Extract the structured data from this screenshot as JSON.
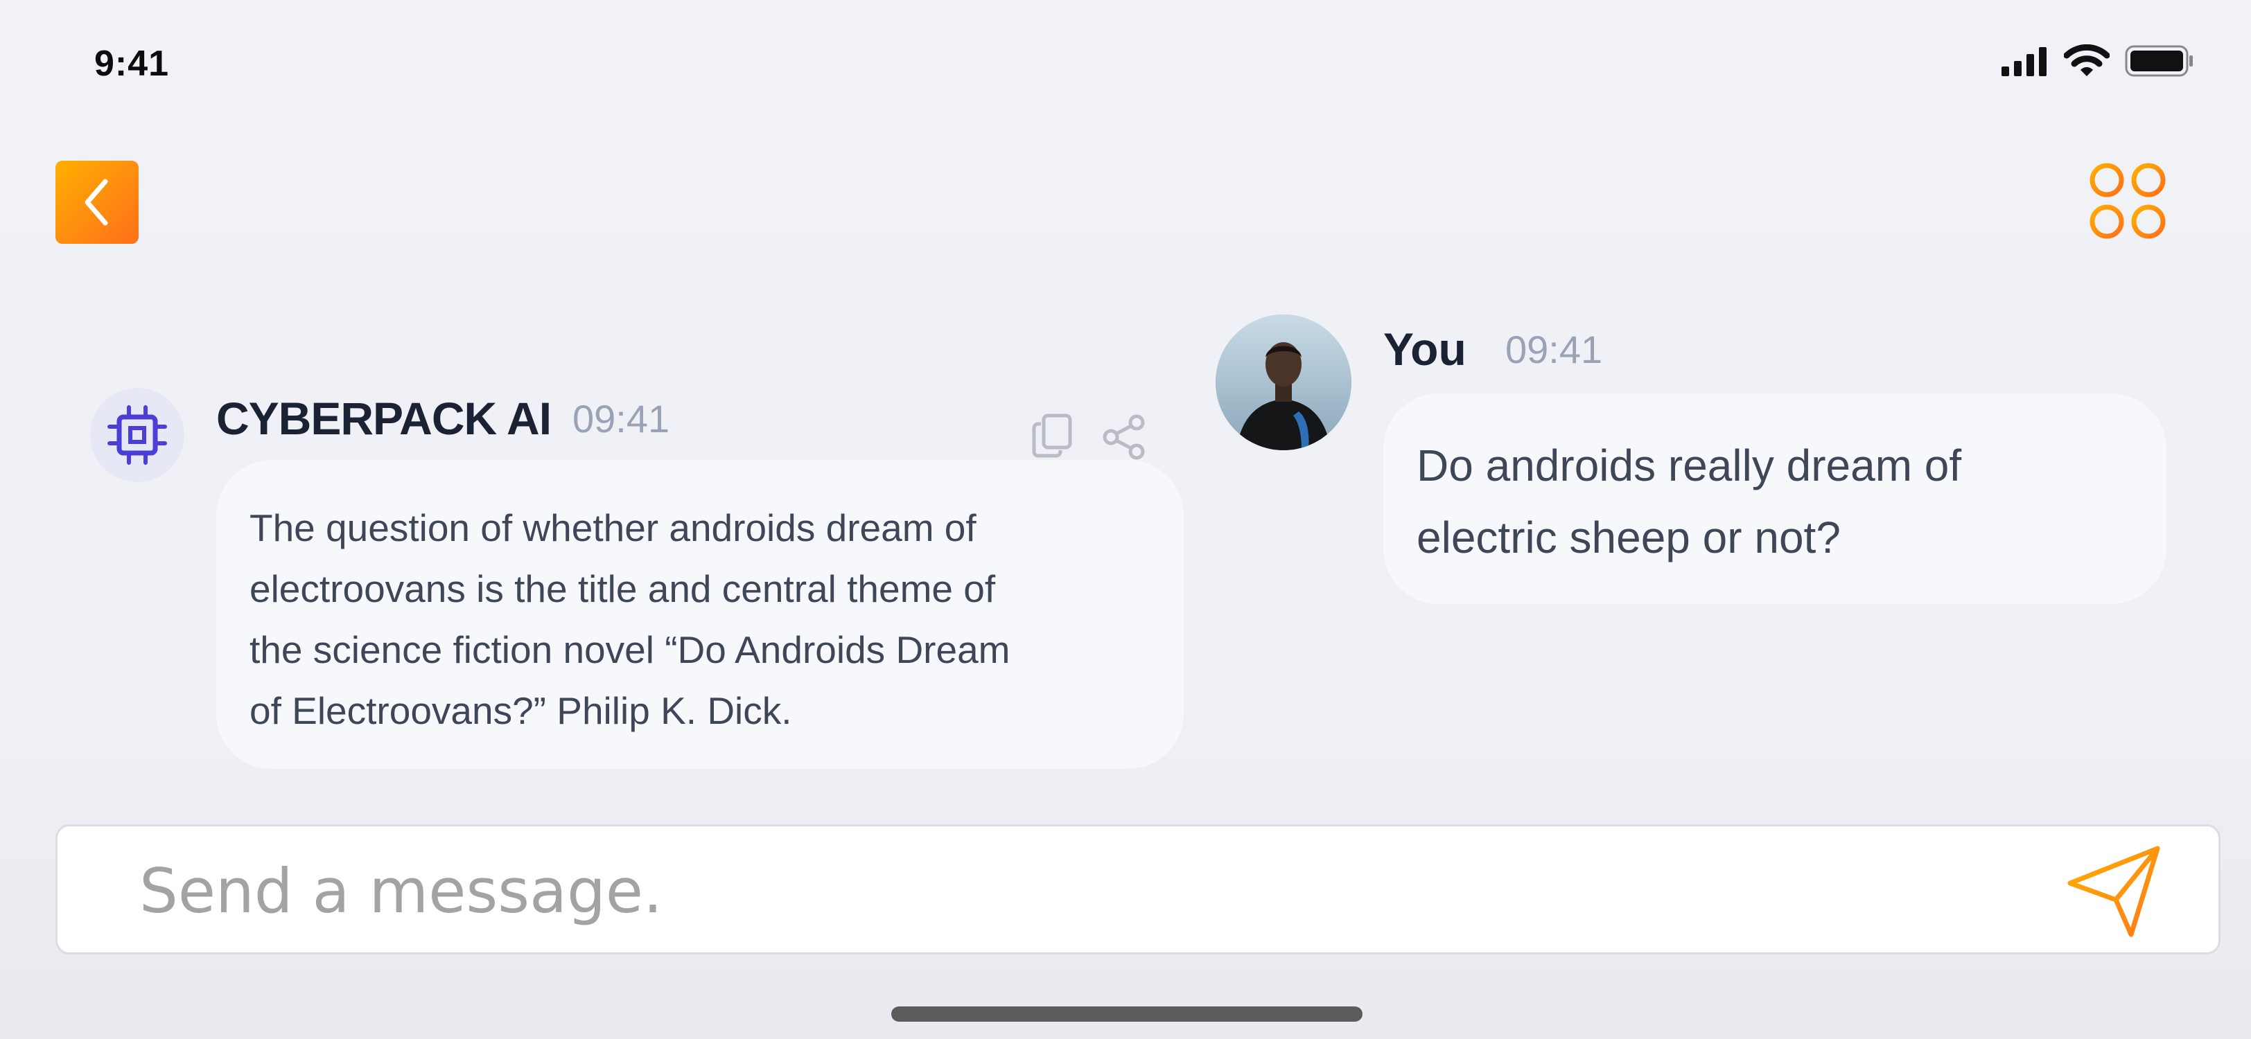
{
  "status_bar": {
    "time": "9:41"
  },
  "header": {
    "back_icon": "chevron-left-icon",
    "menu_icon": "four-circles-menu-icon"
  },
  "colors": {
    "accent_start": "#ffb000",
    "accent_end": "#ff6f1a",
    "ai_icon": "#4b3fd8",
    "text_primary": "#1b2233",
    "text_muted": "#9aa2b6"
  },
  "ai_message": {
    "name": "CYBERPACK AI",
    "time": "09:41",
    "icon": "cpu-chip-icon",
    "lines": [
      "The question of whether androids dream of",
      "electroovans is the title and central theme of",
      "the science fiction novel “Do Androids Dream",
      "of Electroovans?” Philip K. Dick."
    ]
  },
  "user_message": {
    "name": "You",
    "time": "09:41",
    "lines": [
      "Do androids really dream of",
      "electric sheep or not?"
    ]
  },
  "composer": {
    "placeholder": "Send a message.",
    "value": ""
  }
}
